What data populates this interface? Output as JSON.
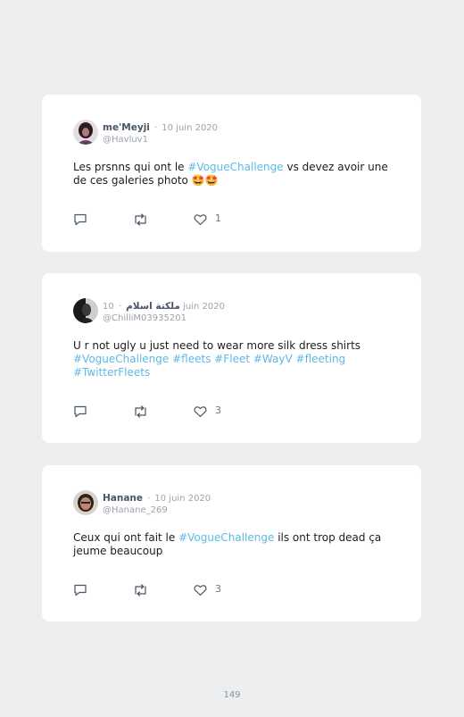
{
  "posts": [
    {
      "name": "me'Meyji",
      "date": "10 juin 2020",
      "handle": "@Havluv1",
      "text_before": "Les prsnns qui ont le ",
      "hashtag": "#VogueChallenge",
      "text_after": " vs devez avoir une de ces galeries photo ",
      "emoji": "🤩🤩",
      "likes": "1"
    },
    {
      "name": "ملكتة اسلام",
      "date": "10 juin 2020",
      "handle": "@ChilliM03935201",
      "text": "U r not ugly u just need to wear more silk dress shirts",
      "hashtags": [
        "#VogueChallenge",
        "#fleets",
        "#Fleet",
        "#WayV",
        "#fleeting",
        "#TwitterFleets"
      ],
      "likes": "3"
    },
    {
      "name": "Hanane",
      "date": "10 juin 2020",
      "handle": "@Hanane_269",
      "text_before": "Ceux qui ont fait le ",
      "hashtag": "#VogueChallenge",
      "text_after": " ils ont trop dead ça jeume beaucoup",
      "likes": "3"
    }
  ],
  "separator": "·",
  "page_number": "149",
  "colors": {
    "hashtag": "#5fb8e6",
    "background": "#eceef0",
    "card": "#ffffff"
  },
  "icons": [
    "reply-icon",
    "retweet-icon",
    "heart-icon"
  ]
}
